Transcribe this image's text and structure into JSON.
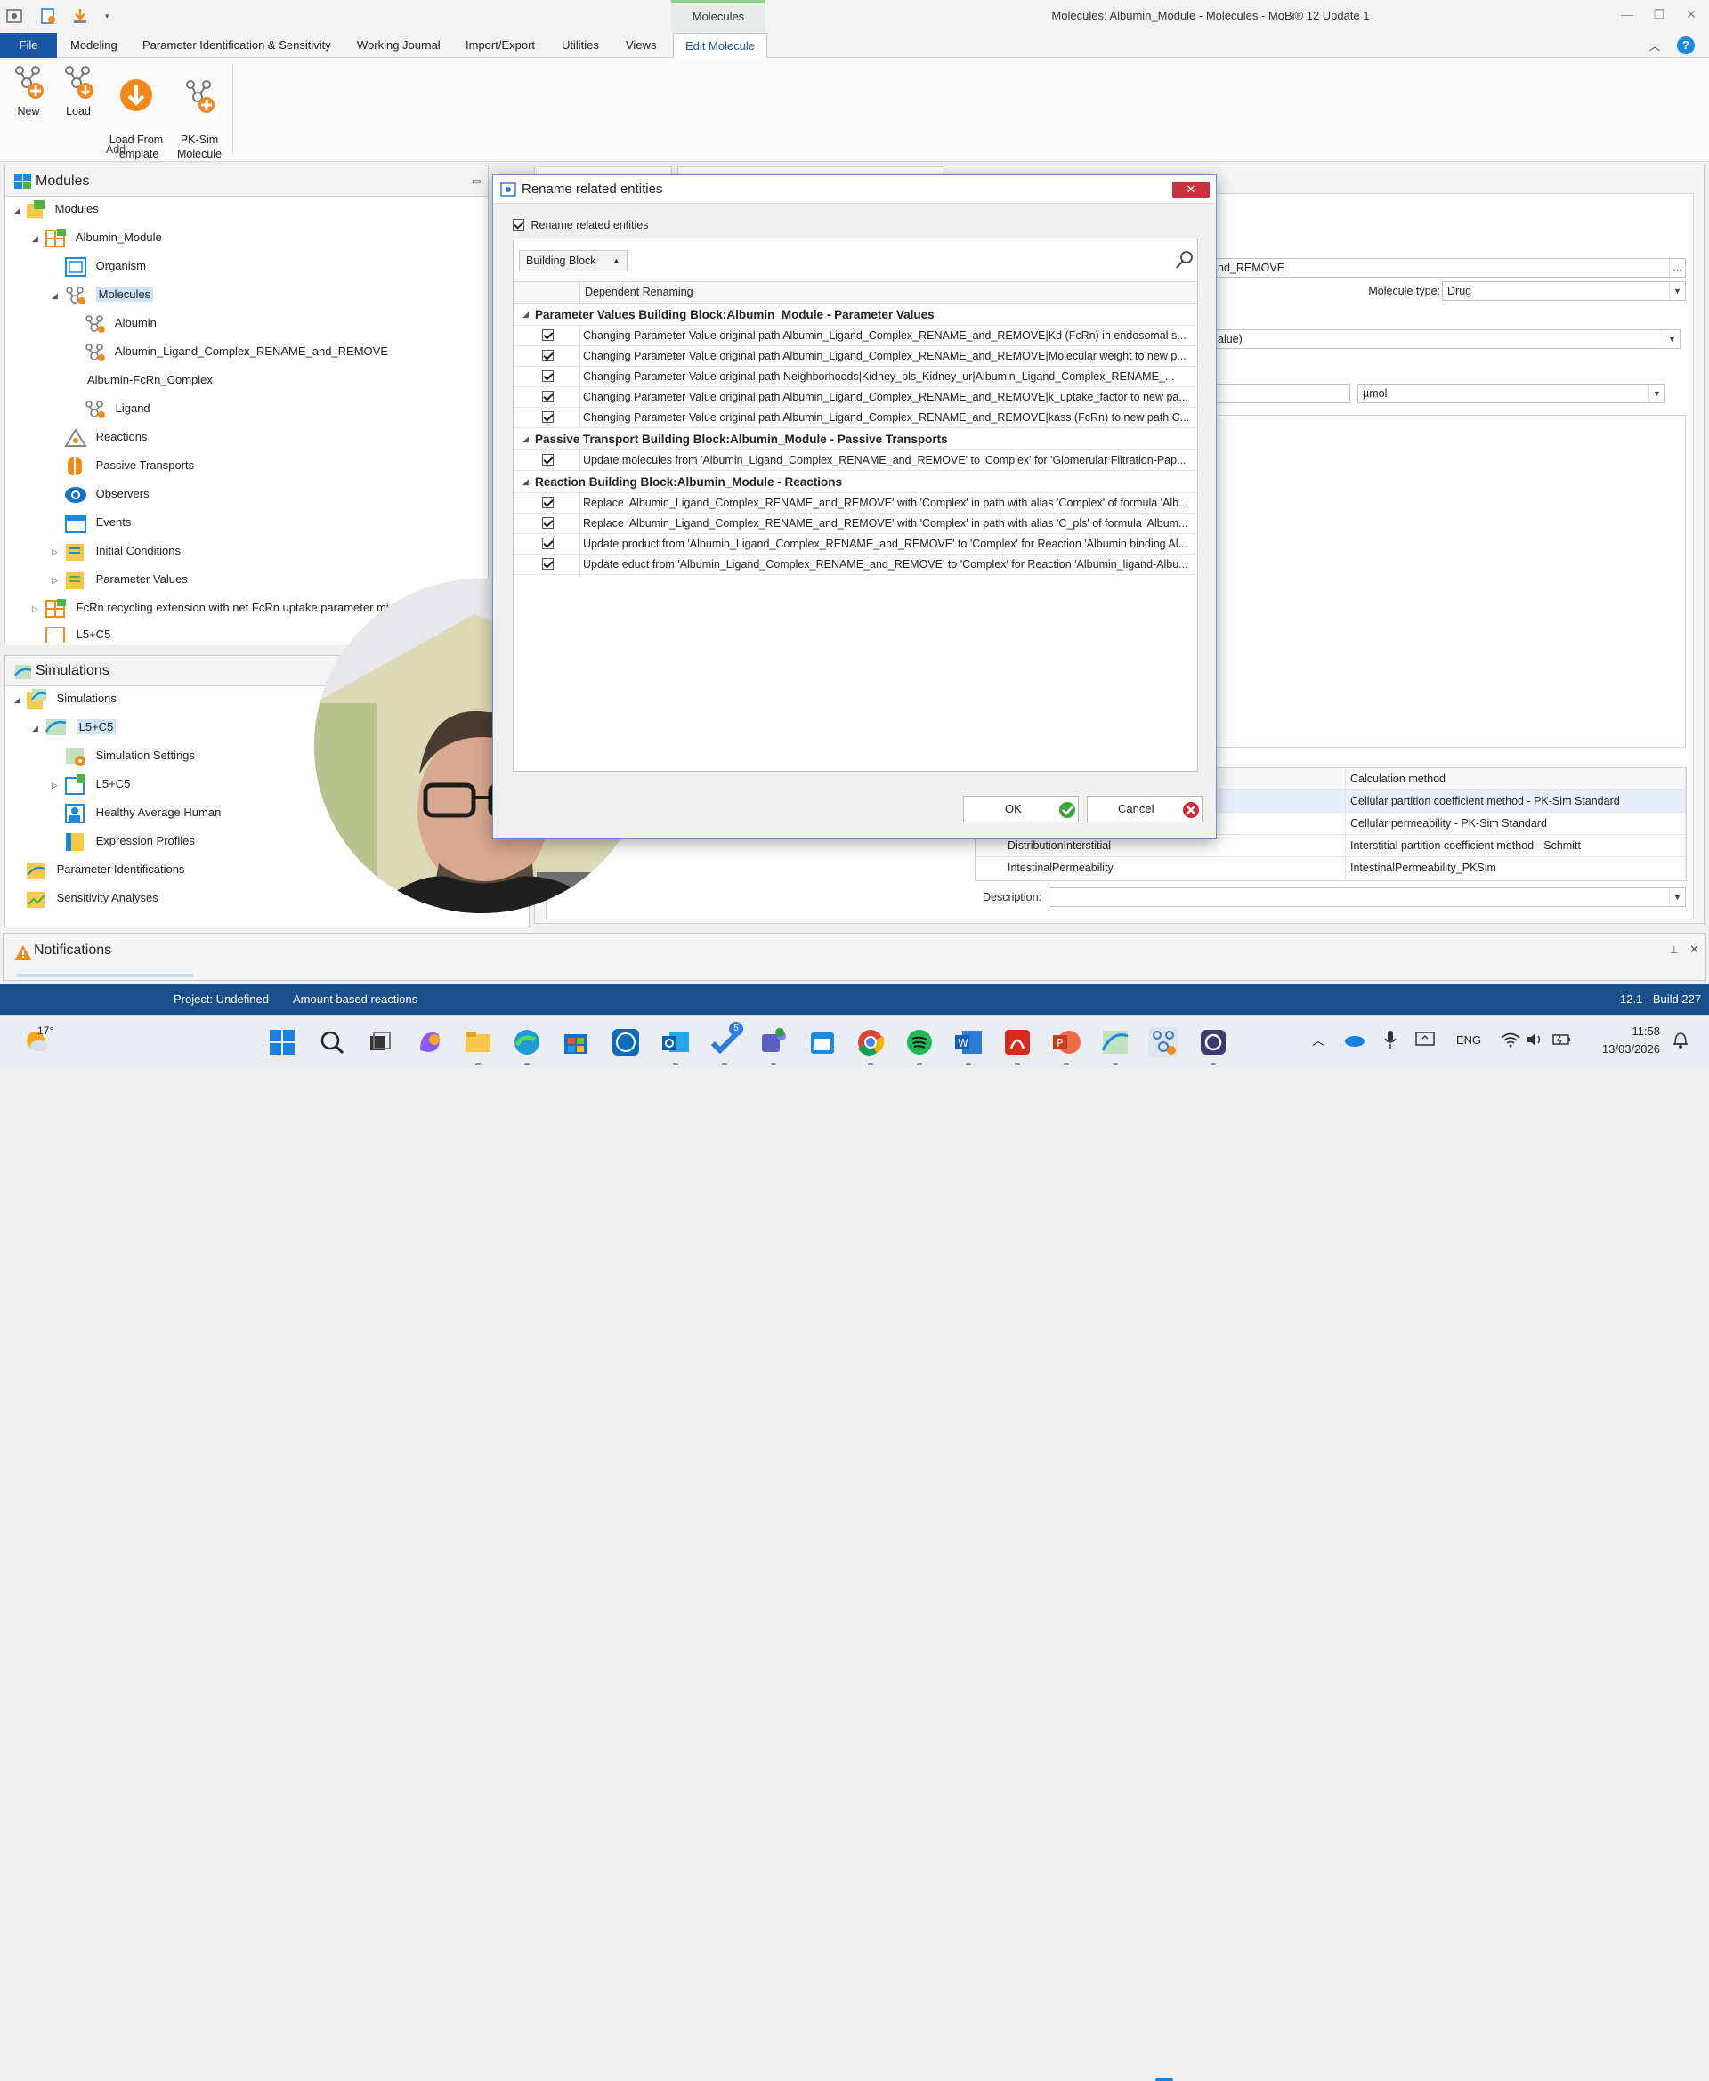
{
  "window": {
    "contextual_tab_title": "Molecules",
    "title": "Molecules: Albumin_Module - Molecules - MoBi® 12 Update 1"
  },
  "menu": {
    "tabs": [
      "File",
      "Modeling",
      "Parameter Identification & Sensitivity",
      "Working Journal",
      "Import/Export",
      "Utilities",
      "Views",
      "Edit Molecule"
    ]
  },
  "ribbon": {
    "buttons": [
      "New",
      "Load",
      "Load From\nTemplate",
      "PK-Sim\nMolecule"
    ],
    "group_label": "Add"
  },
  "modules_panel": {
    "title": "Modules",
    "tree": [
      "Modules",
      "Albumin_Module",
      "Organism",
      "Molecules",
      "Albumin",
      "Albumin_Ligand_Complex_RENAME_and_REMOVE",
      "Albumin-FcRn_Complex",
      "Ligand",
      "Reactions",
      "Passive Transports",
      "Observers",
      "Events",
      "Initial Conditions",
      "Parameter Values",
      "FcRn recycling extension with net FcRn uptake parameter mi",
      "L5+C5"
    ]
  },
  "simulations_panel": {
    "title": "Simulations",
    "tree": [
      "Simulations",
      "L5+C5",
      "Simulation Settings",
      "L5+C5",
      "Healthy Average Human",
      "Expression Profiles",
      "Parameter Identifications",
      "Sensitivity Analyses"
    ]
  },
  "notifications_panel": {
    "title": "Notifications"
  },
  "editor": {
    "name_value": "nd_REMOVE",
    "molecule_type_label": "Molecule type:",
    "molecule_type_value": "Drug",
    "value_field": "alue)",
    "unit_value": "µmol",
    "calc_header": "Calculation method",
    "calc_rows": [
      {
        "name": "",
        "method": "Cellular partition coefficient method - PK-Sim Standard"
      },
      {
        "name": "",
        "method": "Cellular permeability - PK-Sim Standard"
      },
      {
        "name": "DistributionInterstitial",
        "method": "Interstitial partition coefficient method - Schmitt"
      },
      {
        "name": "IntestinalPermeability",
        "method": "IntestinalPermeability_PKSim"
      }
    ],
    "description_label": "Description:"
  },
  "dialog": {
    "title": "Rename related entities",
    "checkbox_label": "Rename related entities",
    "groupby_value": "Building Block",
    "column_header": "Dependent Renaming",
    "groups": [
      {
        "title": "Parameter Values Building Block:Albumin_Module - Parameter Values",
        "rows": [
          "Changing Parameter Value original path Albumin_Ligand_Complex_RENAME_and_REMOVE|Kd (FcRn) in endosomal s...",
          "Changing Parameter Value original path Albumin_Ligand_Complex_RENAME_and_REMOVE|Molecular weight to new p...",
          "Changing Parameter Value original path Neighborhoods|Kidney_pls_Kidney_ur|Albumin_Ligand_Complex_RENAME_...",
          "Changing Parameter Value original path Albumin_Ligand_Complex_RENAME_and_REMOVE|k_uptake_factor to new pa...",
          "Changing Parameter Value original path Albumin_Ligand_Complex_RENAME_and_REMOVE|kass (FcRn) to new path C..."
        ]
      },
      {
        "title": "Passive Transport Building Block:Albumin_Module - Passive Transports",
        "rows": [
          "Update molecules from 'Albumin_Ligand_Complex_RENAME_and_REMOVE' to 'Complex' for  'Glomerular Filtration-Pap..."
        ]
      },
      {
        "title": "Reaction Building Block:Albumin_Module - Reactions",
        "rows": [
          "Replace 'Albumin_Ligand_Complex_RENAME_and_REMOVE' with 'Complex' in path with alias 'Complex' of formula 'Alb...",
          "Replace 'Albumin_Ligand_Complex_RENAME_and_REMOVE' with 'Complex' in path with alias 'C_pls' of formula 'Album...",
          "Update product from 'Albumin_Ligand_Complex_RENAME_and_REMOVE' to 'Complex' for Reaction 'Albumin binding Al...",
          "Update educt from 'Albumin_Ligand_Complex_RENAME_and_REMOVE' to 'Complex' for Reaction 'Albumin_ligand-Albu..."
        ]
      }
    ],
    "ok_label": "OK",
    "cancel_label": "Cancel"
  },
  "statusbar": {
    "project": "Project: Undefined",
    "mode": "Amount based reactions",
    "build": "12.1 - Build 227"
  },
  "taskbar": {
    "weather": "17°",
    "language": "ENG",
    "time": "11:58",
    "date": "13/03/2026",
    "badge_count": "5"
  },
  "colors": {
    "accent": "#1a56a6",
    "statusbar": "#1a4f8c",
    "close_red": "#c8323c",
    "ok_green": "#3aa53a",
    "icon_orange": "#f08a1c"
  }
}
